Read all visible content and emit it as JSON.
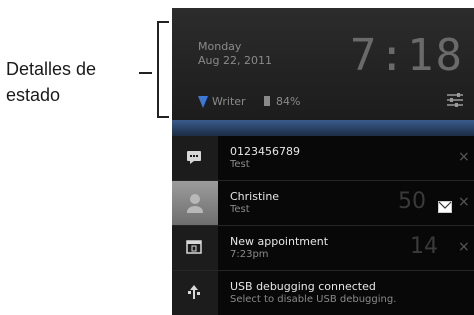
{
  "annotation": {
    "line1": "Detalles de",
    "line2": "estado"
  },
  "status_panel": {
    "day": "Monday",
    "date": "Aug 22, 2011",
    "time": "7:18",
    "network_name": "Writer",
    "battery_level": "84%",
    "icons": [
      "wifi-icon",
      "battery-icon",
      "settings-icon"
    ]
  },
  "notifications": [
    {
      "title": "0123456789",
      "subtitle": "Test",
      "count": "",
      "icon": "message-icon",
      "dismiss": "×"
    },
    {
      "title": "Christine",
      "subtitle": "Test",
      "count": "50",
      "icon": "avatar",
      "dismiss": "×"
    },
    {
      "title": "New appointment",
      "subtitle": "7:23pm",
      "count": "14",
      "icon": "calendar-icon",
      "dismiss": "×"
    },
    {
      "title": "USB debugging connected",
      "subtitle": "Select to disable USB debugging.",
      "count": "",
      "icon": "usb-icon",
      "dismiss": ""
    }
  ],
  "colors": {
    "panel_bg": "#222222",
    "accent_blue": "#3a5b8c",
    "text_primary": "#e6e6e6",
    "text_secondary": "#8a8a8a"
  }
}
